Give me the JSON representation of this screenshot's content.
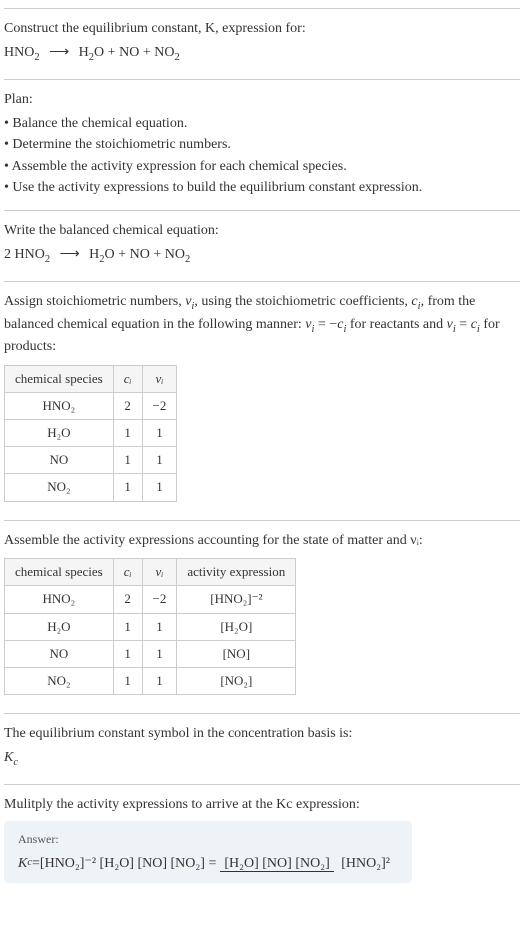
{
  "intro": {
    "title": "Construct the equilibrium constant, K, expression for:",
    "equation_lhs": "HNO",
    "equation_lhs_sub": "2",
    "equation_rhs_1": "H",
    "equation_rhs_1_sub": "2",
    "equation_rhs_1_tail": "O",
    "equation_rhs_2": "NO",
    "equation_rhs_3": "NO",
    "equation_rhs_3_sub": "2"
  },
  "plan": {
    "heading": "Plan:",
    "items": [
      "• Balance the chemical equation.",
      "• Determine the stoichiometric numbers.",
      "• Assemble the activity expression for each chemical species.",
      "• Use the activity expressions to build the equilibrium constant expression."
    ]
  },
  "balanced": {
    "heading": "Write the balanced chemical equation:",
    "coeff_lhs": "2",
    "lhs": "HNO",
    "lhs_sub": "2",
    "rhs_1": "H",
    "rhs_1_sub": "2",
    "rhs_1_tail": "O",
    "rhs_2": "NO",
    "rhs_3": "NO",
    "rhs_3_sub": "2"
  },
  "stoich": {
    "text1": "Assign stoichiometric numbers, ",
    "nu": "ν",
    "sub_i": "i",
    "text2": ", using the stoichiometric coefficients, ",
    "c": "c",
    "text3": ", from the balanced chemical equation in the following manner: ",
    "rel1_lhs": "ν",
    "rel1_eq": " = −",
    "rel1_rhs": "c",
    "text4": " for reactants and ",
    "rel2_lhs": "ν",
    "rel2_eq": " = ",
    "rel2_rhs": "c",
    "text5": " for products:",
    "headers": {
      "h1": "chemical species",
      "h2": "cᵢ",
      "h3": "νᵢ"
    },
    "rows": [
      {
        "species": "HNO₂",
        "ci": "2",
        "nui": "−2"
      },
      {
        "species": "H₂O",
        "ci": "1",
        "nui": "1"
      },
      {
        "species": "NO",
        "ci": "1",
        "nui": "1"
      },
      {
        "species": "NO₂",
        "ci": "1",
        "nui": "1"
      }
    ]
  },
  "activity": {
    "heading": "Assemble the activity expressions accounting for the state of matter and νᵢ:",
    "headers": {
      "h1": "chemical species",
      "h2": "cᵢ",
      "h3": "νᵢ",
      "h4": "activity expression"
    },
    "rows": [
      {
        "species": "HNO₂",
        "ci": "2",
        "nui": "−2",
        "expr": "[HNO₂]⁻²"
      },
      {
        "species": "H₂O",
        "ci": "1",
        "nui": "1",
        "expr": "[H₂O]"
      },
      {
        "species": "NO",
        "ci": "1",
        "nui": "1",
        "expr": "[NO]"
      },
      {
        "species": "NO₂",
        "ci": "1",
        "nui": "1",
        "expr": "[NO₂]"
      }
    ]
  },
  "symbol": {
    "heading": "The equilibrium constant symbol in the concentration basis is:",
    "kc": "K",
    "kc_sub": "c"
  },
  "multiply": {
    "heading": "Mulitply the activity expressions to arrive at the Kc expression:"
  },
  "answer": {
    "label": "Answer:",
    "kc": "K",
    "kc_sub": "c",
    "eq": " = ",
    "plain": "[HNO₂]⁻² [H₂O] [NO] [NO₂] = ",
    "num": "[H₂O] [NO] [NO₂]",
    "den": "[HNO₂]²"
  },
  "chart_data": null
}
